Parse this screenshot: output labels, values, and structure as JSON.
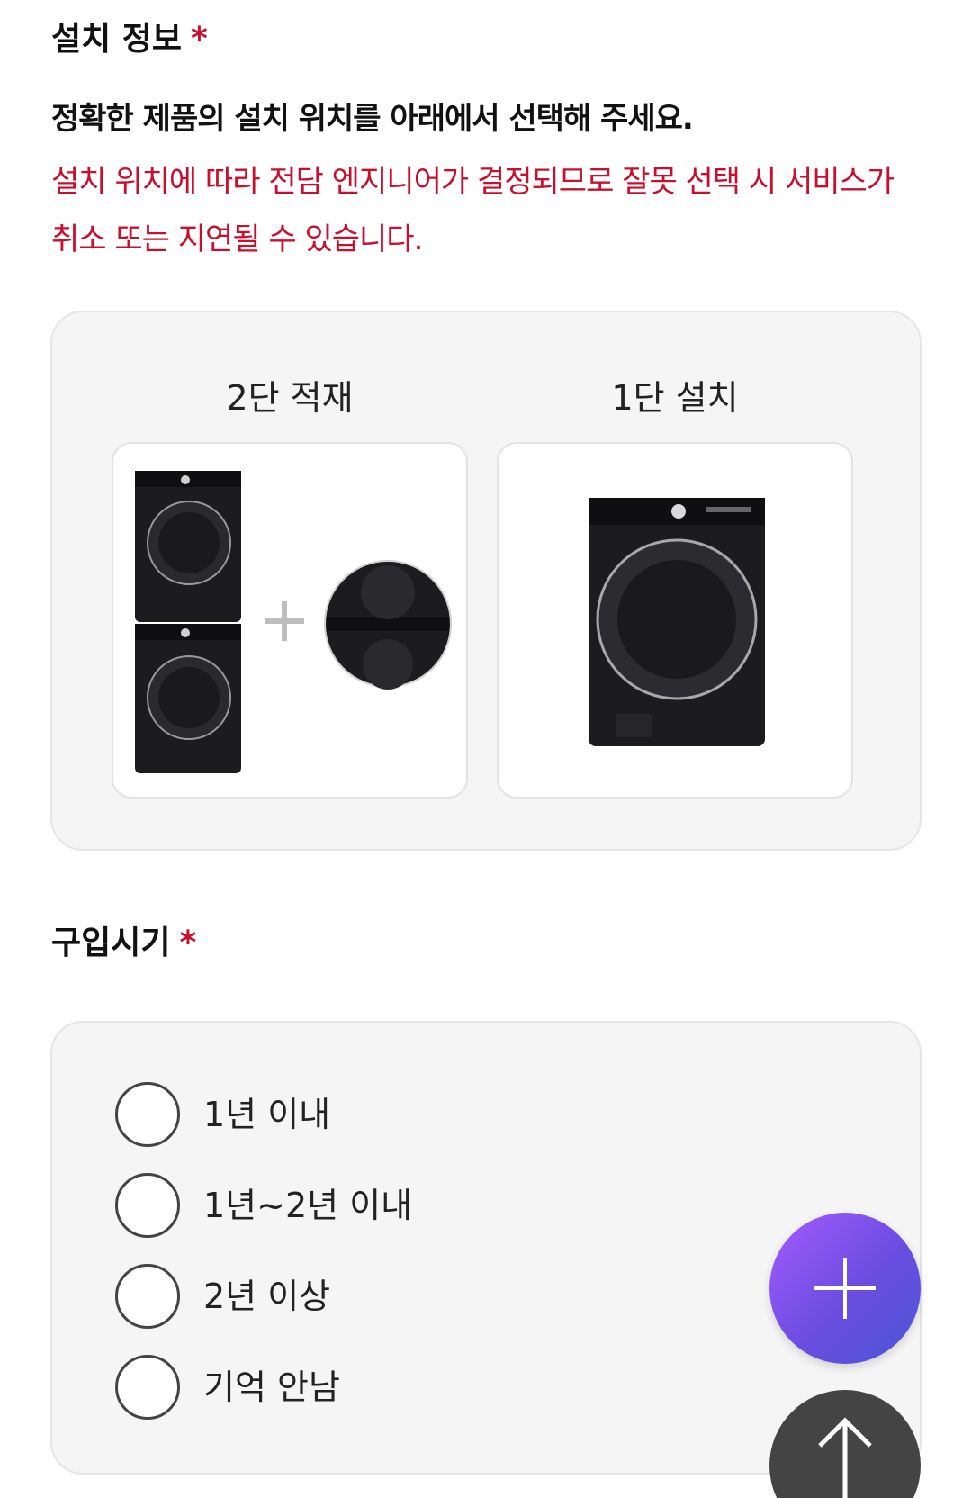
{
  "install_info": {
    "title": "설치 정보",
    "required_mark": "*",
    "instruction": "정확한 제품의 설치 위치를 아래에서 선택해 주세요.",
    "warning": "설치 위치에 따라 전담 엔지니어가 결정되므로 잘못 선택 시 서비스가 취소 또는 지연될 수 있습니다.",
    "options": [
      {
        "label": "2단 적재",
        "image_icon": "stacked-washer-dryer-image"
      },
      {
        "label": "1단 설치",
        "image_icon": "single-washer-image"
      }
    ]
  },
  "purchase_period": {
    "title": "구입시기",
    "required_mark": "*",
    "options": [
      {
        "label": "1년 이내",
        "selected": false
      },
      {
        "label": "1년~2년 이내",
        "selected": false
      },
      {
        "label": "2년 이상",
        "selected": false
      },
      {
        "label": "기억 안남",
        "selected": false
      }
    ]
  },
  "floating_buttons": {
    "add_icon": "plus-icon",
    "top_icon": "arrow-up-icon"
  },
  "colors": {
    "required": "#c8102e",
    "warning_text": "#c8102e",
    "panel_bg": "#f5f5f5",
    "fab_gradient_start": "#a55bff",
    "fab_gradient_end": "#4b56d6",
    "scroll_top_bg": "#444444"
  }
}
